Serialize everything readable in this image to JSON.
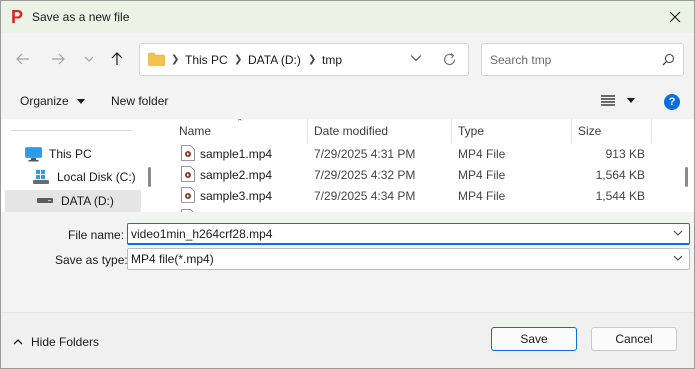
{
  "window": {
    "title": "Save as a new file",
    "app_icon_letter": "P",
    "app_icon_color": "#e0261b"
  },
  "address": {
    "crumbs": [
      "This PC",
      "DATA (D:)",
      "tmp"
    ]
  },
  "search": {
    "placeholder": "Search tmp"
  },
  "toolbar": {
    "organize_label": "Organize",
    "new_folder_label": "New folder",
    "help_label": "?"
  },
  "sidebar": {
    "items": [
      {
        "label": "This PC",
        "icon": "monitor-icon"
      },
      {
        "label": "Local Disk (C:)",
        "icon": "windows-drive-icon"
      },
      {
        "label": "DATA (D:)",
        "icon": "drive-icon",
        "selected": true
      }
    ]
  },
  "files": {
    "columns": [
      "Name",
      "Date modified",
      "Type",
      "Size"
    ],
    "rows": [
      {
        "name": "sample1.mp4",
        "date": "7/29/2025 4:31 PM",
        "type": "MP4 File",
        "size": "913 KB"
      },
      {
        "name": "sample2.mp4",
        "date": "7/29/2025 4:32 PM",
        "type": "MP4 File",
        "size": "1,564 KB"
      },
      {
        "name": "sample3.mp4",
        "date": "7/29/2025 4:34 PM",
        "type": "MP4 File",
        "size": "1,544 KB"
      }
    ]
  },
  "form": {
    "file_name_label": "File name:",
    "file_name_value": "video1min_h264crf28.mp4",
    "save_type_label": "Save as type:",
    "save_type_value": "MP4 file(*.mp4)"
  },
  "footer": {
    "hide_folders_label": "Hide Folders",
    "save_label": "Save",
    "cancel_label": "Cancel"
  },
  "colors": {
    "accent": "#0a6ee0",
    "titlebar_bg": "#eaf3e6",
    "folder": "#f2c14e"
  }
}
